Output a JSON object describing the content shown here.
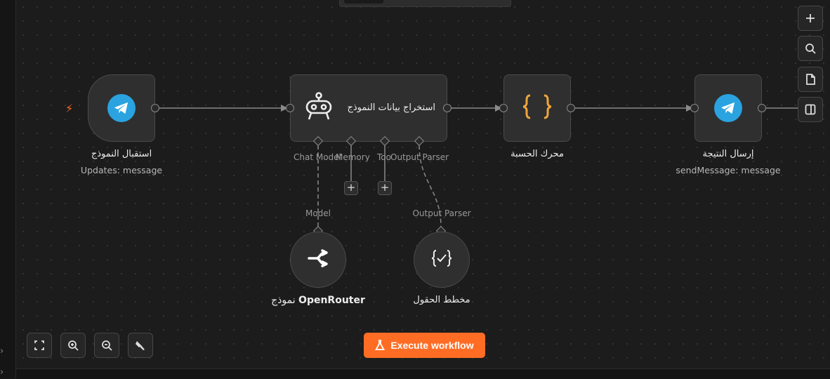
{
  "colors": {
    "canvas_bg": "#1c1c1c",
    "node_bg": "#2f2f2f",
    "accent_orange": "#ff6d24",
    "telegram_blue": "#2aa3e0",
    "code_brace": "#f0a63c"
  },
  "nodes": {
    "trigger": {
      "title": "استقبال النموذج",
      "subtitle": "Updates: message",
      "icon": "telegram-icon"
    },
    "agent": {
      "title": "استخراج بيانات النموذج",
      "icon": "robot-icon",
      "ports": [
        "Chat Model",
        "Memory",
        "Too",
        "Output Parser"
      ]
    },
    "code": {
      "title": "محرك الحسبة",
      "icon": "code-braces-icon"
    },
    "send": {
      "title": "إرسال النتيجة",
      "subtitle": "sendMessage: message",
      "icon": "telegram-icon"
    },
    "model": {
      "title_bold": "OpenRouter",
      "title_rest": "نموذج",
      "port_label": "Model",
      "icon": "openrouter-icon"
    },
    "parser": {
      "title": "مخطط الحقول",
      "port_label": "Output Parser",
      "icon": "structured-parser-icon"
    }
  },
  "toolbar_right": [
    "plus-icon",
    "search-icon",
    "sticky-note-icon",
    "panel-icon"
  ],
  "toolbar_bottom": [
    "fit-view-icon",
    "zoom-in-icon",
    "zoom-out-icon",
    "tidy-up-icon"
  ],
  "execute_button": {
    "label": "Execute workflow",
    "icon": "flask-icon"
  },
  "plus_symbol": "+"
}
